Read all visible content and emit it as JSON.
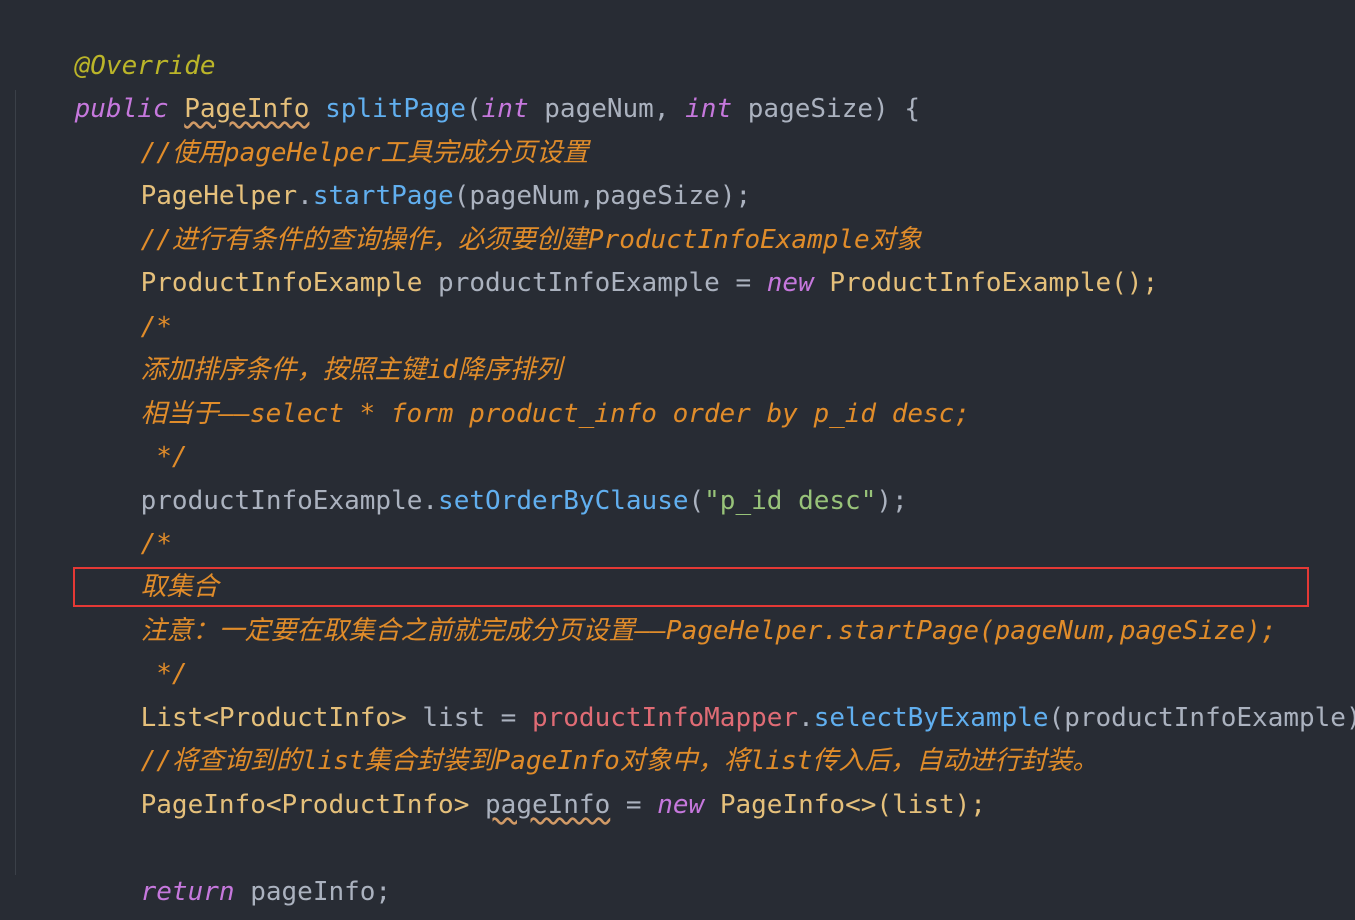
{
  "editor": {
    "annotation": "@Override",
    "signature": {
      "modifier": "public",
      "return_type": "PageInfo",
      "method": "splitPage",
      "open_paren": "(",
      "p1_type": "int",
      "p1_name": "pageNum,",
      "p2_type": "int",
      "p2_name": "pageSize",
      "close": ") {"
    },
    "comment1": "//使用pageHelper工具完成分页设置",
    "start_page": {
      "obj": "PageHelper",
      "dot": ".",
      "method": "startPage",
      "args": "(pageNum,pageSize);"
    },
    "comment2": "//进行有条件的查询操作，必须要创建ProductInfoExample对象",
    "example_decl": {
      "type": "ProductInfoExample",
      "var": " productInfoExample = ",
      "new_kw": "new",
      "ctor": " ProductInfoExample();"
    },
    "block1": {
      "open": "/*",
      "line1": "添加排序条件，按照主键id降序排列",
      "line2": "相当于——select * form product_info order by p_id desc;",
      "close": " */"
    },
    "order_call": {
      "obj": "productInfoExample",
      "dot": ".",
      "method": "setOrderByClause",
      "open": "(",
      "arg": "\"p_id desc\"",
      "close": ");"
    },
    "block2": {
      "open": "/*",
      "line1": "取集合",
      "line2": "注意：一定要在取集合之前就完成分页设置——PageHelper.startPage(pageNum,pageSize);",
      "close": " */"
    },
    "list_decl": {
      "type": "List<ProductInfo>",
      "var": " list = ",
      "field": "productInfoMapper",
      "dot": ".",
      "method": "selectByExample",
      "args": "(productInfoExample);"
    },
    "comment3": "//将查询到的list集合封装到PageInfo对象中，将list传入后，自动进行封装。",
    "pageinfo_decl": {
      "type": "PageInfo<ProductInfo>",
      "space": " ",
      "var": "pageInfo",
      "eq": " = ",
      "new_kw": "new",
      "ctor": " PageInfo<>(list);"
    },
    "return_stmt": {
      "kw": "return",
      "value": " pageInfo;"
    },
    "closing_brace": "}"
  },
  "colors": {
    "background": "#282c34",
    "comment": "#e08c2a",
    "keyword": "#c678dd",
    "method": "#61afef",
    "string": "#98c379",
    "highlight_border": "#e53935"
  }
}
